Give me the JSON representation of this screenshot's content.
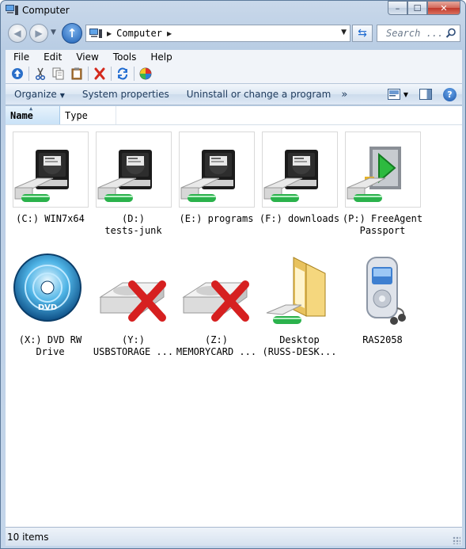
{
  "window": {
    "title": "Computer"
  },
  "titlebar": {
    "minimize": "–",
    "maximize": "☐",
    "close": "✕"
  },
  "nav": {
    "back_icon": "back-arrow-icon",
    "forward_icon": "forward-arrow-icon",
    "up_icon": "up-arrow-icon"
  },
  "address": {
    "path": "Computer"
  },
  "search": {
    "placeholder": "Search ..."
  },
  "menu": [
    "File",
    "Edit",
    "View",
    "Tools",
    "Help"
  ],
  "commandbar": {
    "organize": "Organize",
    "system_properties": "System properties",
    "uninstall": "Uninstall or change a program",
    "more": "»"
  },
  "columns": {
    "name": "Name",
    "type": "Type"
  },
  "items": [
    {
      "label": "(C:) WIN7x64",
      "icon": "hard-drive-icon"
    },
    {
      "label": "(D:)\ntests-junk",
      "icon": "hard-drive-icon"
    },
    {
      "label": "(E:) programs",
      "icon": "hard-drive-icon"
    },
    {
      "label": "(F:) downloads",
      "icon": "hard-drive-icon"
    },
    {
      "label": "(P:) FreeAgent\nPassport",
      "icon": "external-drive-icon"
    },
    {
      "label": "(X:) DVD RW\nDrive",
      "icon": "dvd-drive-icon"
    },
    {
      "label": "(Y:)\nUSBSTORAGE ...",
      "icon": "disconnected-network-drive-icon"
    },
    {
      "label": "(Z:)\nMEMORYCARD ...",
      "icon": "disconnected-network-drive-icon"
    },
    {
      "label": "Desktop\n(RUSS-DESK...",
      "icon": "network-folder-icon"
    },
    {
      "label": "RAS2058",
      "icon": "media-player-device-icon"
    }
  ],
  "status": {
    "count": "10 items"
  },
  "colors": {
    "accent": "#1f6bd1",
    "frame": "#b9cde4",
    "disconnected": "#d62020"
  }
}
